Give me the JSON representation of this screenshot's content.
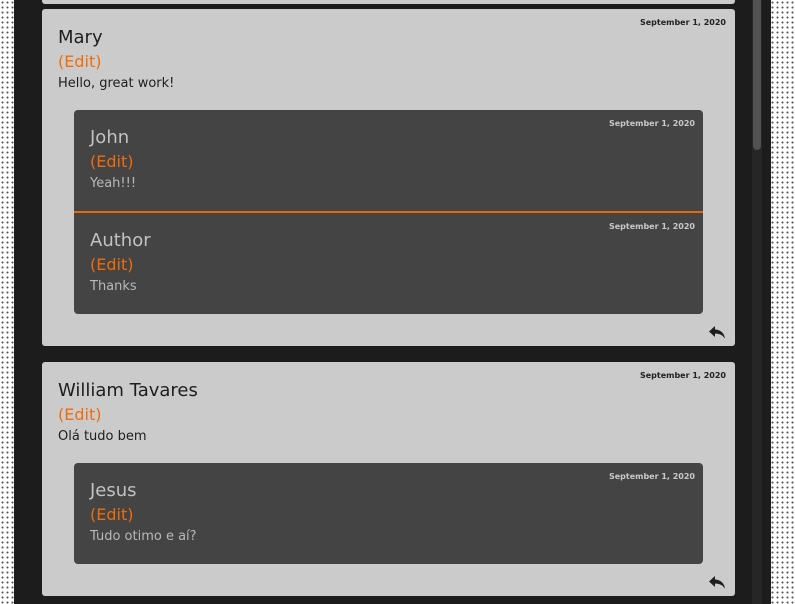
{
  "comments": [
    {
      "author": "Mary",
      "edit_label": "(Edit)",
      "date": "September 1, 2020",
      "message": "Hello, great work!",
      "reply_icon": "reply-icon",
      "replies": [
        {
          "author": "John",
          "edit_label": "(Edit)",
          "date": "September 1, 2020",
          "message": "Yeah!!!"
        },
        {
          "author": "Author",
          "edit_label": "(Edit)",
          "date": "September 1, 2020",
          "message": "Thanks"
        }
      ]
    },
    {
      "author": "William Tavares",
      "edit_label": "(Edit)",
      "date": "September 1, 2020",
      "message": "Olá tudo bem",
      "reply_icon": "reply-icon",
      "replies": [
        {
          "author": "Jesus",
          "edit_label": "(Edit)",
          "date": "September 1, 2020",
          "message": "Tudo otimo e aí?"
        }
      ]
    }
  ],
  "colors": {
    "accent": "#f06c0a",
    "card_bg": "#cbcbcb",
    "reply_bg": "#444444",
    "column_bg": "#1c1c1c"
  }
}
